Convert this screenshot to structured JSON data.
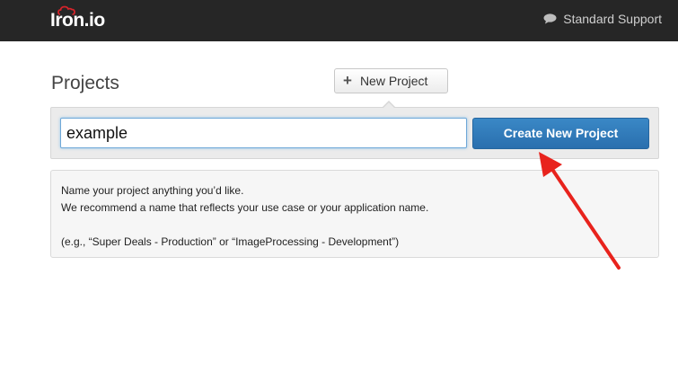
{
  "header": {
    "logo_text": "Iron.io",
    "support_label": "Standard Support",
    "support_icon": "speech-bubble-icon"
  },
  "main": {
    "title": "Projects",
    "new_project_label": "New Project",
    "new_project_icon": "plus-icon",
    "project_name_value": "example",
    "create_label": "Create New Project",
    "help": {
      "line1": "Name your project anything you’d like.",
      "line2": "We recommend a name that reflects your use case or your application name.",
      "line3": "(e.g., “Super Deals - Production” or “ImageProcessing - Development”)"
    }
  },
  "colors": {
    "topbar": "#262626",
    "create_button": "#2f7bbd",
    "annotation_arrow": "#e8231d"
  }
}
